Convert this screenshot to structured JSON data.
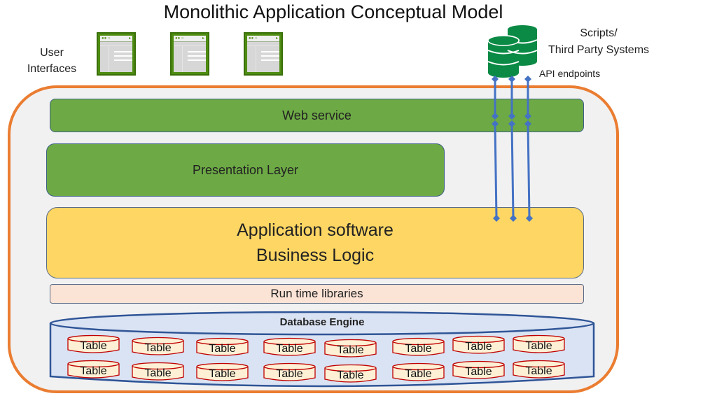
{
  "title": "Monolithic Application Conceptual Model",
  "user_interfaces": {
    "label_line1": "User",
    "label_line2": "Interfaces",
    "windows": [
      {
        "name": "browser-window-1"
      },
      {
        "name": "browser-window-2"
      },
      {
        "name": "browser-window-3"
      }
    ]
  },
  "external": {
    "label_line1": "Scripts/",
    "label_line2": "Third Party Systems",
    "api_label": "API endpoints",
    "icon": "database-stack-icon",
    "connector_count": 3
  },
  "layers": {
    "web_service": "Web service",
    "presentation": "Presentation Layer",
    "application_line1": "Application software",
    "application_line2": "Business Logic",
    "runtime": "Run time libraries"
  },
  "database": {
    "label": "Database Engine",
    "rows": [
      [
        "Table",
        "Table",
        "Table",
        "Table",
        "Table",
        "Table",
        "Table",
        "Table"
      ],
      [
        "Table",
        "Table",
        "Table",
        "Table",
        "Table",
        "Table",
        "Table",
        "Table"
      ]
    ]
  },
  "colors": {
    "outer_border": "#ea7d31",
    "outer_fill": "#f1f1f2",
    "green_layer": "#6daa45",
    "app_layer": "#fdd664",
    "runtime_layer": "#fbe3d6",
    "db_fill": "#dae3f3",
    "db_border": "#2f5597",
    "table_fill": "#fdf0d5",
    "table_border": "#c00000",
    "connector": "#4472c4",
    "db_icon": "#0b8a45",
    "browser_frame": "#4f8c12"
  }
}
